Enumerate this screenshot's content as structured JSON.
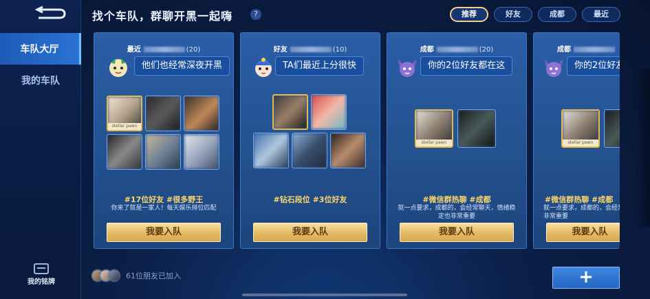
{
  "sidebar": {
    "items": [
      {
        "label": "车队大厅",
        "active": true
      },
      {
        "label": "我的车队",
        "active": false
      }
    ],
    "badge_label": "我的铭牌"
  },
  "header": {
    "title": "找个车队，群聊开黑一起嗨",
    "help": "?",
    "tabs": [
      {
        "label": "推荐",
        "active": true
      },
      {
        "label": "好友",
        "active": false
      },
      {
        "label": "成都",
        "active": false
      },
      {
        "label": "最近",
        "active": false
      }
    ]
  },
  "cards": [
    {
      "tag": "最近",
      "count": "(20)",
      "bubble": "他们也经常深夜开黑",
      "tags": "#17位好友 #很多野王",
      "desc": "你来了就是一家人！每天娱乐排位匹配",
      "join": "我要入队",
      "avatar_caption": "stellar pawn"
    },
    {
      "tag": "好友",
      "count": "(10)",
      "bubble": "TA们最近上分很快",
      "tags": "#钻石段位 #3位好友",
      "desc": "",
      "join": "我要入队"
    },
    {
      "tag": "成都",
      "count": "(20)",
      "bubble": "你的2位好友都在这",
      "tags": "#微信群热聊 #成都",
      "desc": "就一点要求，成都的，会经常聊天，情绪稳定也非常重要",
      "join": "我要入队",
      "avatar_caption": "stellar pawn"
    },
    {
      "tag": "成都",
      "count": "",
      "bubble": "你的2位好友",
      "tags": "#微信群热聊 #成都",
      "desc": "就一点要求，成都的，会经常聊天，情绪稳定也非常重要",
      "join": "我要入队",
      "avatar_caption": "stellar pawn"
    }
  ],
  "footer": {
    "friends_joined": "61位朋友已加入",
    "add_label": "+"
  },
  "colors": {
    "accent_gold": "#e5bd6a",
    "tag_yellow": "#ffd66b",
    "card_blue": "#2b5ea8",
    "background": "#0b1f47"
  }
}
